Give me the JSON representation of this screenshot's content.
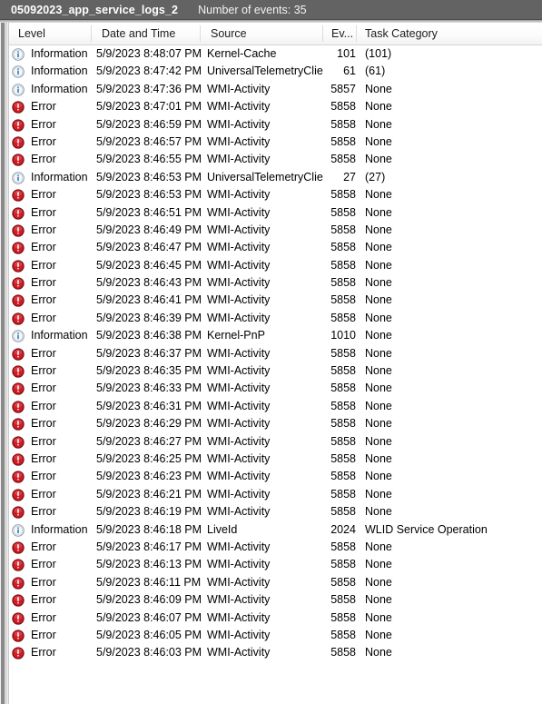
{
  "header": {
    "log_name": "05092023_app_service_logs_2",
    "event_count_label": "Number of events: 35"
  },
  "columns": [
    {
      "key": "level",
      "label": "Level"
    },
    {
      "key": "date",
      "label": "Date and Time"
    },
    {
      "key": "source",
      "label": "Source"
    },
    {
      "key": "eventid",
      "label": "Ev..."
    },
    {
      "key": "task",
      "label": "Task Category"
    }
  ],
  "icons": {
    "information": "information-icon",
    "error": "error-icon"
  },
  "colors": {
    "header_bar_bg": "#636363",
    "header_bar_text": "#ffffff",
    "error_icon": "#c1121c",
    "information_icon": "#1f6fb5",
    "row_text": "#000000",
    "grid_line": "#d6d6d6"
  },
  "rows": [
    {
      "level": "Information",
      "icon": "information",
      "date": "5/9/2023 8:48:07 PM",
      "source": "Kernel-Cache",
      "eventid": "101",
      "task": "(101)"
    },
    {
      "level": "Information",
      "icon": "information",
      "date": "5/9/2023 8:47:42 PM",
      "source": "UniversalTelemetryClient",
      "eventid": "61",
      "task": "(61)"
    },
    {
      "level": "Information",
      "icon": "information",
      "date": "5/9/2023 8:47:36 PM",
      "source": "WMI-Activity",
      "eventid": "5857",
      "task": "None"
    },
    {
      "level": "Error",
      "icon": "error",
      "date": "5/9/2023 8:47:01 PM",
      "source": "WMI-Activity",
      "eventid": "5858",
      "task": "None"
    },
    {
      "level": "Error",
      "icon": "error",
      "date": "5/9/2023 8:46:59 PM",
      "source": "WMI-Activity",
      "eventid": "5858",
      "task": "None"
    },
    {
      "level": "Error",
      "icon": "error",
      "date": "5/9/2023 8:46:57 PM",
      "source": "WMI-Activity",
      "eventid": "5858",
      "task": "None"
    },
    {
      "level": "Error",
      "icon": "error",
      "date": "5/9/2023 8:46:55 PM",
      "source": "WMI-Activity",
      "eventid": "5858",
      "task": "None"
    },
    {
      "level": "Information",
      "icon": "information",
      "date": "5/9/2023 8:46:53 PM",
      "source": "UniversalTelemetryClient",
      "eventid": "27",
      "task": "(27)"
    },
    {
      "level": "Error",
      "icon": "error",
      "date": "5/9/2023 8:46:53 PM",
      "source": "WMI-Activity",
      "eventid": "5858",
      "task": "None"
    },
    {
      "level": "Error",
      "icon": "error",
      "date": "5/9/2023 8:46:51 PM",
      "source": "WMI-Activity",
      "eventid": "5858",
      "task": "None"
    },
    {
      "level": "Error",
      "icon": "error",
      "date": "5/9/2023 8:46:49 PM",
      "source": "WMI-Activity",
      "eventid": "5858",
      "task": "None"
    },
    {
      "level": "Error",
      "icon": "error",
      "date": "5/9/2023 8:46:47 PM",
      "source": "WMI-Activity",
      "eventid": "5858",
      "task": "None"
    },
    {
      "level": "Error",
      "icon": "error",
      "date": "5/9/2023 8:46:45 PM",
      "source": "WMI-Activity",
      "eventid": "5858",
      "task": "None"
    },
    {
      "level": "Error",
      "icon": "error",
      "date": "5/9/2023 8:46:43 PM",
      "source": "WMI-Activity",
      "eventid": "5858",
      "task": "None"
    },
    {
      "level": "Error",
      "icon": "error",
      "date": "5/9/2023 8:46:41 PM",
      "source": "WMI-Activity",
      "eventid": "5858",
      "task": "None"
    },
    {
      "level": "Error",
      "icon": "error",
      "date": "5/9/2023 8:46:39 PM",
      "source": "WMI-Activity",
      "eventid": "5858",
      "task": "None"
    },
    {
      "level": "Information",
      "icon": "information",
      "date": "5/9/2023 8:46:38 PM",
      "source": "Kernel-PnP",
      "eventid": "1010",
      "task": "None"
    },
    {
      "level": "Error",
      "icon": "error",
      "date": "5/9/2023 8:46:37 PM",
      "source": "WMI-Activity",
      "eventid": "5858",
      "task": "None"
    },
    {
      "level": "Error",
      "icon": "error",
      "date": "5/9/2023 8:46:35 PM",
      "source": "WMI-Activity",
      "eventid": "5858",
      "task": "None"
    },
    {
      "level": "Error",
      "icon": "error",
      "date": "5/9/2023 8:46:33 PM",
      "source": "WMI-Activity",
      "eventid": "5858",
      "task": "None"
    },
    {
      "level": "Error",
      "icon": "error",
      "date": "5/9/2023 8:46:31 PM",
      "source": "WMI-Activity",
      "eventid": "5858",
      "task": "None"
    },
    {
      "level": "Error",
      "icon": "error",
      "date": "5/9/2023 8:46:29 PM",
      "source": "WMI-Activity",
      "eventid": "5858",
      "task": "None"
    },
    {
      "level": "Error",
      "icon": "error",
      "date": "5/9/2023 8:46:27 PM",
      "source": "WMI-Activity",
      "eventid": "5858",
      "task": "None"
    },
    {
      "level": "Error",
      "icon": "error",
      "date": "5/9/2023 8:46:25 PM",
      "source": "WMI-Activity",
      "eventid": "5858",
      "task": "None"
    },
    {
      "level": "Error",
      "icon": "error",
      "date": "5/9/2023 8:46:23 PM",
      "source": "WMI-Activity",
      "eventid": "5858",
      "task": "None"
    },
    {
      "level": "Error",
      "icon": "error",
      "date": "5/9/2023 8:46:21 PM",
      "source": "WMI-Activity",
      "eventid": "5858",
      "task": "None"
    },
    {
      "level": "Error",
      "icon": "error",
      "date": "5/9/2023 8:46:19 PM",
      "source": "WMI-Activity",
      "eventid": "5858",
      "task": "None"
    },
    {
      "level": "Information",
      "icon": "information",
      "date": "5/9/2023 8:46:18 PM",
      "source": "LiveId",
      "eventid": "2024",
      "task": "WLID Service Operation"
    },
    {
      "level": "Error",
      "icon": "error",
      "date": "5/9/2023 8:46:17 PM",
      "source": "WMI-Activity",
      "eventid": "5858",
      "task": "None"
    },
    {
      "level": "Error",
      "icon": "error",
      "date": "5/9/2023 8:46:13 PM",
      "source": "WMI-Activity",
      "eventid": "5858",
      "task": "None"
    },
    {
      "level": "Error",
      "icon": "error",
      "date": "5/9/2023 8:46:11 PM",
      "source": "WMI-Activity",
      "eventid": "5858",
      "task": "None"
    },
    {
      "level": "Error",
      "icon": "error",
      "date": "5/9/2023 8:46:09 PM",
      "source": "WMI-Activity",
      "eventid": "5858",
      "task": "None"
    },
    {
      "level": "Error",
      "icon": "error",
      "date": "5/9/2023 8:46:07 PM",
      "source": "WMI-Activity",
      "eventid": "5858",
      "task": "None"
    },
    {
      "level": "Error",
      "icon": "error",
      "date": "5/9/2023 8:46:05 PM",
      "source": "WMI-Activity",
      "eventid": "5858",
      "task": "None"
    },
    {
      "level": "Error",
      "icon": "error",
      "date": "5/9/2023 8:46:03 PM",
      "source": "WMI-Activity",
      "eventid": "5858",
      "task": "None"
    }
  ]
}
